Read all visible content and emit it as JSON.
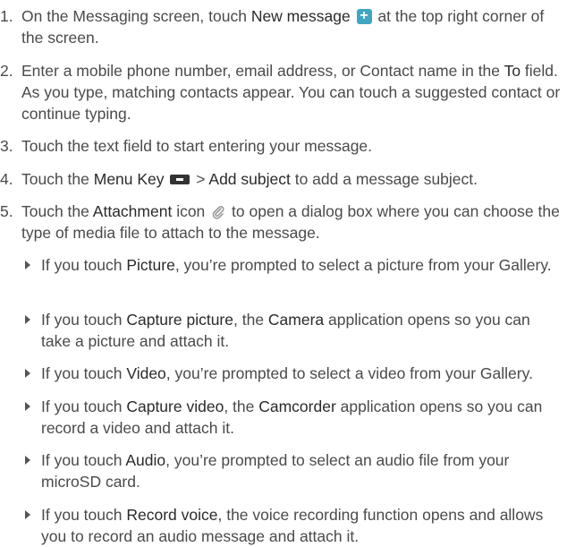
{
  "steps": [
    {
      "num": "1.",
      "pre": "On the Messaging screen, touch ",
      "bold1": "New message",
      "post": " at the top right corner of the screen.",
      "icon": "new-message-icon"
    },
    {
      "num": "2.",
      "pre": "Enter a mobile phone number, email address, or Contact name in the ",
      "bold1": "To",
      "post": " field. As you type, matching contacts appear. You can touch a suggested contact or continue typing."
    },
    {
      "num": "3.",
      "text": "Touch the text field to start entering your message."
    },
    {
      "num": "4.",
      "pre": "Touch the ",
      "bold1": "Menu Key",
      "mid": " > ",
      "bold2": "Add subject",
      "post": " to add a message subject.",
      "icon": "menu-key-icon"
    },
    {
      "num": "5.",
      "pre": "Touch the ",
      "bold1": "Attachment",
      "mid": " icon",
      "post": " to open a dialog box where you can choose the type of media file to attach to the message.",
      "icon": "paperclip-icon"
    }
  ],
  "sub_items": [
    {
      "pre": "If you touch ",
      "bold1": "Picture",
      "post": ", you’re prompted to select a picture from your Gallery."
    },
    {
      "pre": "If you touch ",
      "bold1": "Capture picture",
      "mid": ", the ",
      "bold2": "Camera",
      "post": " application opens so you can take a picture and attach it."
    },
    {
      "pre": "If you touch ",
      "bold1": "Video",
      "post": ", you’re prompted to select a video from your Gallery."
    },
    {
      "pre": "If you touch ",
      "bold1": "Capture video",
      "mid": ", the ",
      "bold2": "Camcorder",
      "post": " application opens so you can record a video and attach it."
    },
    {
      "pre": "If you touch ",
      "bold1": "Audio",
      "post": ", you’re prompted to select an audio file from your microSD card."
    },
    {
      "pre": "If you touch ",
      "bold1": "Record voice",
      "post": ", the voice recording function opens and allows you to record an audio message and attach it."
    }
  ],
  "colors": {
    "text": "#4a4a4a",
    "emphasis": "#2a2a2a",
    "new_message_icon": "#3fa7c4"
  }
}
